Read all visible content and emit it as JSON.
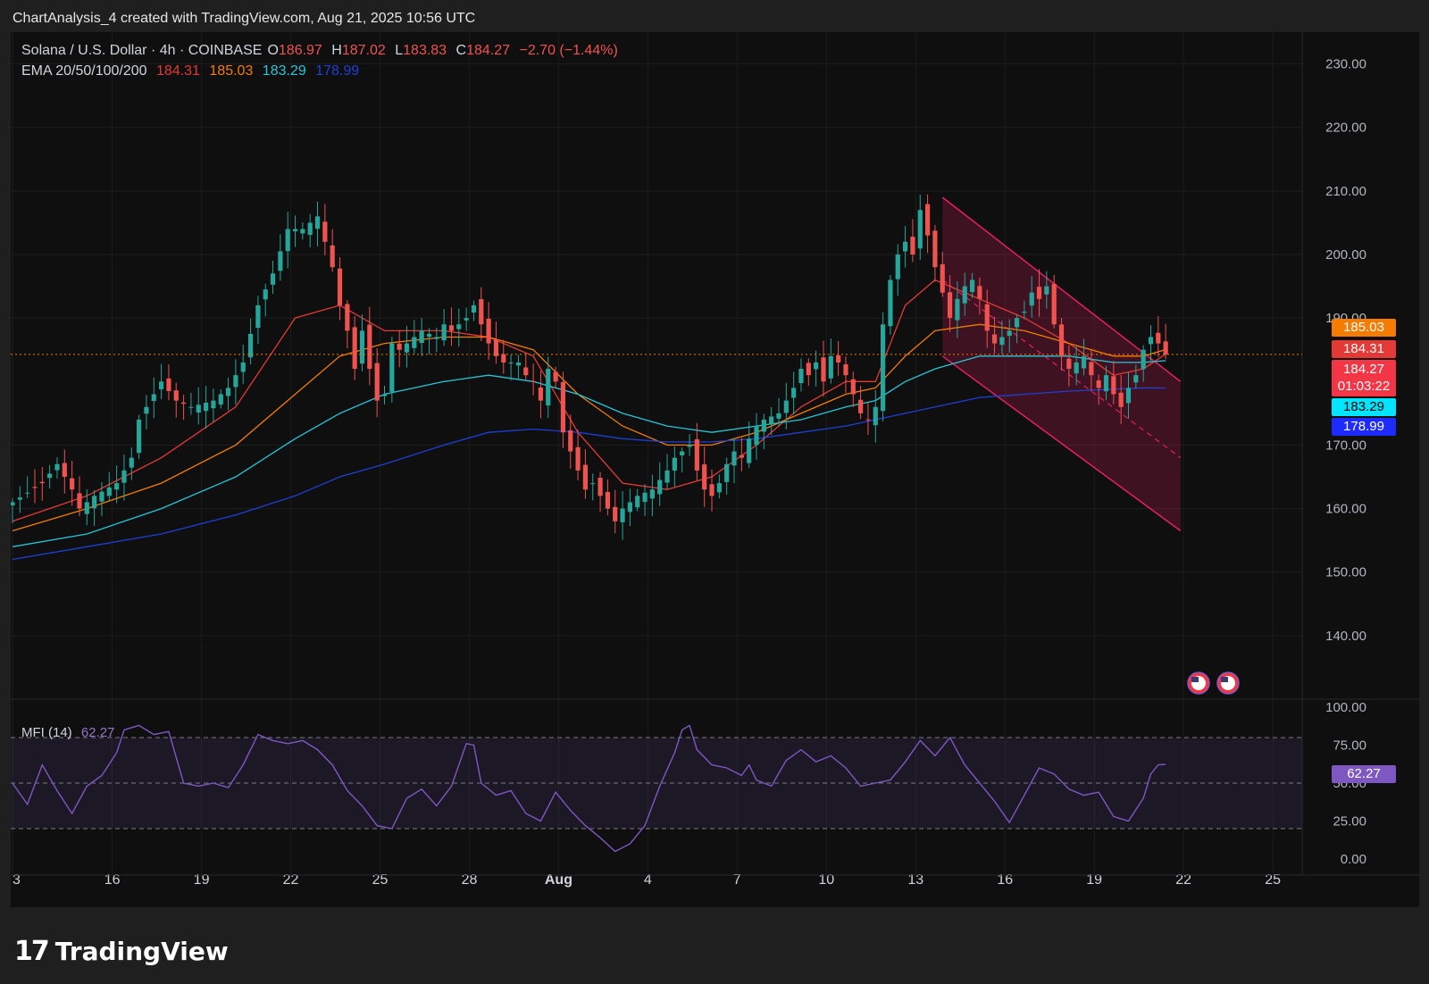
{
  "header": {
    "attribution": "ChartAnalysis_4 created with TradingView.com, Aug 21, 2025 10:56 UTC"
  },
  "legend": {
    "symbol": "Solana / U.S. Dollar · 4h · COINBASE",
    "o_label": "O",
    "o_value": "186.97",
    "h_label": "H",
    "h_value": "187.02",
    "l_label": "L",
    "l_value": "183.83",
    "c_label": "C",
    "c_value": "184.27",
    "change": "−2.70 (−1.44%)",
    "ema_label": "EMA 20/50/100/200",
    "ema20": "184.31",
    "ema50": "185.03",
    "ema100": "183.29",
    "ema200": "178.99"
  },
  "mfi": {
    "label": "MFI (14)",
    "value": "62.27"
  },
  "price_tags": {
    "ema50": "185.03",
    "ema20": "184.31",
    "last": "184.27",
    "countdown": "01:03:22",
    "ema100": "183.29",
    "ema200": "178.99",
    "mfi": "62.27"
  },
  "colors": {
    "up": "#26a69a",
    "down": "#ef5350",
    "ema20": "#e53935",
    "ema50": "#f57c00",
    "ema100": "#26c6da",
    "ema200": "#1e3fd6",
    "mfi": "#7e57c2",
    "channel": "#e91e63"
  },
  "footer": {
    "brand": "TradingView"
  },
  "chart_data": {
    "type": "candlestick",
    "title": "Solana / U.S. Dollar · 4h · COINBASE",
    "ylim": [
      130,
      235
    ],
    "y_ticks": [
      "230.00",
      "220.00",
      "210.00",
      "200.00",
      "190.00",
      "170.00",
      "160.00",
      "150.00",
      "140.00"
    ],
    "x_ticks": [
      "3",
      "16",
      "19",
      "22",
      "25",
      "28",
      "Aug",
      "4",
      "7",
      "10",
      "13",
      "16",
      "19",
      "22",
      "25"
    ],
    "x_tick_index": [
      0,
      13.4,
      25.4,
      37.4,
      49.4,
      61.4,
      73.4,
      85.4,
      97.4,
      109.4,
      121.4,
      133.4,
      145.4,
      157.4,
      169.4
    ],
    "close_path": [
      [
        0,
        161
      ],
      [
        4,
        164
      ],
      [
        6,
        167
      ],
      [
        8,
        163
      ],
      [
        9,
        160
      ],
      [
        11,
        162
      ],
      [
        14,
        164
      ],
      [
        16,
        168
      ],
      [
        17,
        174
      ],
      [
        18,
        176
      ],
      [
        20,
        180
      ],
      [
        22,
        177
      ],
      [
        24,
        176
      ],
      [
        27,
        177
      ],
      [
        29,
        179
      ],
      [
        31,
        183
      ],
      [
        33,
        192
      ],
      [
        35,
        197
      ],
      [
        37,
        204
      ],
      [
        39,
        204
      ],
      [
        41,
        206
      ],
      [
        42,
        202
      ],
      [
        43,
        198
      ],
      [
        44,
        192
      ],
      [
        45,
        188
      ],
      [
        46,
        182
      ],
      [
        47,
        188
      ],
      [
        48,
        182
      ],
      [
        49,
        177
      ],
      [
        50,
        178
      ],
      [
        51,
        186
      ],
      [
        52,
        185
      ],
      [
        54,
        187
      ],
      [
        55,
        188
      ],
      [
        57,
        187
      ],
      [
        58,
        189
      ],
      [
        59,
        188
      ],
      [
        61,
        190
      ],
      [
        62,
        192
      ],
      [
        63,
        189
      ],
      [
        64,
        186
      ],
      [
        65,
        184
      ],
      [
        66,
        183
      ],
      [
        68,
        183
      ],
      [
        69,
        181
      ],
      [
        70,
        180
      ],
      [
        71,
        177
      ],
      [
        72,
        182
      ],
      [
        73,
        180
      ],
      [
        74,
        172
      ],
      [
        75,
        169
      ],
      [
        76,
        166
      ],
      [
        77,
        163
      ],
      [
        78,
        164
      ],
      [
        79,
        162
      ],
      [
        80,
        160
      ],
      [
        81,
        158
      ],
      [
        82,
        160
      ],
      [
        83,
        161
      ],
      [
        84,
        162
      ],
      [
        86,
        163
      ],
      [
        88,
        166
      ],
      [
        89,
        168
      ],
      [
        91,
        170
      ],
      [
        92,
        166
      ],
      [
        93,
        163
      ],
      [
        94,
        162
      ],
      [
        95,
        164
      ],
      [
        96,
        167
      ],
      [
        97,
        169
      ],
      [
        98,
        168
      ],
      [
        99,
        171
      ],
      [
        100,
        173
      ],
      [
        101,
        174
      ],
      [
        103,
        175
      ],
      [
        104,
        177
      ],
      [
        105,
        179
      ],
      [
        106,
        182
      ],
      [
        107,
        181
      ],
      [
        108,
        183
      ],
      [
        109,
        180
      ],
      [
        110,
        184
      ],
      [
        111,
        183
      ],
      [
        112,
        181
      ],
      [
        113,
        178
      ],
      [
        114,
        175
      ],
      [
        115,
        174
      ],
      [
        116,
        176
      ],
      [
        117,
        189
      ],
      [
        118,
        196
      ],
      [
        119,
        200
      ],
      [
        120,
        202
      ],
      [
        121,
        200
      ],
      [
        122,
        207
      ],
      [
        123,
        203
      ],
      [
        124,
        198
      ],
      [
        125,
        194
      ],
      [
        126,
        190
      ],
      [
        127,
        193
      ],
      [
        128,
        195
      ],
      [
        129,
        196
      ],
      [
        130,
        193
      ],
      [
        131,
        188
      ],
      [
        132,
        186
      ],
      [
        133,
        187
      ],
      [
        134,
        188
      ],
      [
        135,
        190
      ],
      [
        136,
        191
      ],
      [
        137,
        194
      ],
      [
        138,
        193
      ],
      [
        139,
        195
      ],
      [
        140,
        189
      ],
      [
        141,
        184
      ],
      [
        142,
        182
      ],
      [
        143,
        183
      ],
      [
        144,
        184
      ],
      [
        145,
        181
      ],
      [
        146,
        179
      ],
      [
        147,
        181
      ],
      [
        148,
        178
      ],
      [
        149,
        176
      ],
      [
        150,
        179
      ],
      [
        151,
        181
      ],
      [
        152,
        185
      ],
      [
        153,
        187
      ],
      [
        154,
        186
      ],
      [
        155,
        184.27
      ]
    ],
    "ema": {
      "ema20": {
        "name": "EMA 20",
        "value": 184.31,
        "points": [
          [
            0,
            158
          ],
          [
            10,
            162
          ],
          [
            20,
            168
          ],
          [
            30,
            176
          ],
          [
            38,
            190
          ],
          [
            44,
            192
          ],
          [
            50,
            188
          ],
          [
            58,
            188
          ],
          [
            64,
            187
          ],
          [
            70,
            184
          ],
          [
            76,
            172
          ],
          [
            82,
            164
          ],
          [
            88,
            163
          ],
          [
            94,
            165
          ],
          [
            100,
            170
          ],
          [
            106,
            176
          ],
          [
            112,
            180
          ],
          [
            116,
            180
          ],
          [
            120,
            192
          ],
          [
            124,
            196
          ],
          [
            130,
            193
          ],
          [
            136,
            190
          ],
          [
            142,
            186
          ],
          [
            148,
            181
          ],
          [
            152,
            182
          ],
          [
            155,
            184.31
          ]
        ]
      },
      "ema50": {
        "name": "EMA 50",
        "value": 185.03,
        "points": [
          [
            0,
            156.5
          ],
          [
            10,
            160
          ],
          [
            20,
            164
          ],
          [
            30,
            170
          ],
          [
            38,
            178
          ],
          [
            44,
            184
          ],
          [
            50,
            186
          ],
          [
            58,
            187
          ],
          [
            64,
            187
          ],
          [
            70,
            185
          ],
          [
            76,
            178
          ],
          [
            82,
            173
          ],
          [
            88,
            170
          ],
          [
            94,
            170
          ],
          [
            100,
            172
          ],
          [
            106,
            175
          ],
          [
            112,
            178
          ],
          [
            116,
            179
          ],
          [
            120,
            184
          ],
          [
            124,
            188
          ],
          [
            130,
            189
          ],
          [
            136,
            188
          ],
          [
            142,
            186
          ],
          [
            148,
            184
          ],
          [
            152,
            184
          ],
          [
            155,
            185.03
          ]
        ]
      },
      "ema100": {
        "name": "EMA 100",
        "value": 183.29,
        "points": [
          [
            0,
            154
          ],
          [
            10,
            156
          ],
          [
            20,
            160
          ],
          [
            30,
            165
          ],
          [
            38,
            171
          ],
          [
            44,
            175
          ],
          [
            50,
            178
          ],
          [
            58,
            180
          ],
          [
            64,
            181
          ],
          [
            70,
            180
          ],
          [
            76,
            178
          ],
          [
            82,
            175
          ],
          [
            88,
            173
          ],
          [
            94,
            172
          ],
          [
            100,
            173
          ],
          [
            106,
            174
          ],
          [
            112,
            176
          ],
          [
            116,
            177
          ],
          [
            120,
            180
          ],
          [
            124,
            182
          ],
          [
            130,
            184
          ],
          [
            136,
            184
          ],
          [
            142,
            184
          ],
          [
            148,
            183
          ],
          [
            152,
            183
          ],
          [
            155,
            183.29
          ]
        ]
      },
      "ema200": {
        "name": "EMA 200",
        "value": 178.99,
        "points": [
          [
            0,
            152
          ],
          [
            10,
            154
          ],
          [
            20,
            156
          ],
          [
            30,
            159
          ],
          [
            38,
            162
          ],
          [
            44,
            165
          ],
          [
            50,
            167
          ],
          [
            58,
            170
          ],
          [
            64,
            172
          ],
          [
            70,
            172.5
          ],
          [
            76,
            172
          ],
          [
            82,
            171
          ],
          [
            88,
            170.5
          ],
          [
            94,
            170.5
          ],
          [
            100,
            171
          ],
          [
            106,
            172
          ],
          [
            112,
            173
          ],
          [
            116,
            174
          ],
          [
            120,
            175
          ],
          [
            124,
            176
          ],
          [
            130,
            177.5
          ],
          [
            136,
            178
          ],
          [
            142,
            178.5
          ],
          [
            148,
            178.8
          ],
          [
            152,
            179
          ],
          [
            155,
            178.99
          ]
        ]
      }
    },
    "channel": {
      "upper": [
        [
          125,
          209
        ],
        [
          157,
          180
        ]
      ],
      "lower": [
        [
          125,
          184
        ],
        [
          157,
          156.5
        ]
      ],
      "mid": [
        [
          125,
          196
        ],
        [
          157,
          168
        ]
      ]
    },
    "last_price": 184.27,
    "mfi": {
      "ylim": [
        0,
        100
      ],
      "y_ticks": [
        "100.00",
        "75.00",
        "50.00",
        "25.00",
        "0.00"
      ],
      "bands": [
        20,
        50,
        80
      ],
      "points": [
        [
          0,
          50
        ],
        [
          2,
          36
        ],
        [
          4,
          62
        ],
        [
          6,
          45
        ],
        [
          8,
          30
        ],
        [
          10,
          48
        ],
        [
          12,
          55
        ],
        [
          14,
          70
        ],
        [
          15,
          85
        ],
        [
          17,
          88
        ],
        [
          19,
          82
        ],
        [
          21,
          84
        ],
        [
          23,
          50
        ],
        [
          25,
          48
        ],
        [
          27,
          50
        ],
        [
          29,
          47
        ],
        [
          31,
          62
        ],
        [
          33,
          82
        ],
        [
          35,
          78
        ],
        [
          37,
          76
        ],
        [
          39,
          78
        ],
        [
          41,
          72
        ],
        [
          43,
          62
        ],
        [
          45,
          45
        ],
        [
          47,
          35
        ],
        [
          49,
          22
        ],
        [
          51,
          20
        ],
        [
          53,
          40
        ],
        [
          55,
          46
        ],
        [
          57,
          35
        ],
        [
          59,
          48
        ],
        [
          61,
          76
        ],
        [
          62,
          75
        ],
        [
          63,
          50
        ],
        [
          65,
          42
        ],
        [
          67,
          45
        ],
        [
          69,
          30
        ],
        [
          71,
          25
        ],
        [
          73,
          44
        ],
        [
          75,
          32
        ],
        [
          77,
          22
        ],
        [
          79,
          14
        ],
        [
          81,
          5
        ],
        [
          83,
          10
        ],
        [
          85,
          22
        ],
        [
          87,
          48
        ],
        [
          89,
          70
        ],
        [
          90,
          85
        ],
        [
          91,
          88
        ],
        [
          92,
          72
        ],
        [
          94,
          62
        ],
        [
          96,
          60
        ],
        [
          98,
          55
        ],
        [
          99,
          62
        ],
        [
          100,
          52
        ],
        [
          102,
          48
        ],
        [
          104,
          65
        ],
        [
          106,
          72
        ],
        [
          108,
          64
        ],
        [
          110,
          68
        ],
        [
          112,
          60
        ],
        [
          114,
          48
        ],
        [
          116,
          50
        ],
        [
          118,
          52
        ],
        [
          120,
          64
        ],
        [
          122,
          78
        ],
        [
          124,
          68
        ],
        [
          126,
          80
        ],
        [
          128,
          62
        ],
        [
          130,
          50
        ],
        [
          132,
          38
        ],
        [
          134,
          24
        ],
        [
          136,
          42
        ],
        [
          138,
          60
        ],
        [
          140,
          56
        ],
        [
          142,
          46
        ],
        [
          144,
          42
        ],
        [
          146,
          44
        ],
        [
          148,
          28
        ],
        [
          150,
          25
        ],
        [
          152,
          40
        ],
        [
          153,
          56
        ],
        [
          154,
          62
        ],
        [
          155,
          62.27
        ]
      ]
    }
  }
}
